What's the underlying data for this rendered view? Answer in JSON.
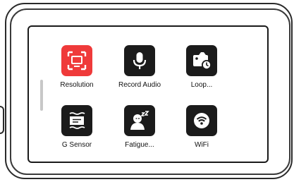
{
  "menu": {
    "items": [
      {
        "label": "Resolution",
        "icon": "resolution-icon",
        "active": true
      },
      {
        "label": "Record Audio",
        "icon": "microphone-icon",
        "active": false
      },
      {
        "label": "Loop...",
        "icon": "loop-recording-icon",
        "active": false
      },
      {
        "label": "G Sensor",
        "icon": "g-sensor-icon",
        "active": false
      },
      {
        "label": "Fatigue...",
        "icon": "fatigue-driving-icon",
        "active": false
      },
      {
        "label": "WiFi",
        "icon": "wifi-icon",
        "active": false
      }
    ]
  },
  "colors": {
    "active": "#ef3a3a",
    "icon_bg": "#1b1b1b",
    "text": "#111111"
  }
}
